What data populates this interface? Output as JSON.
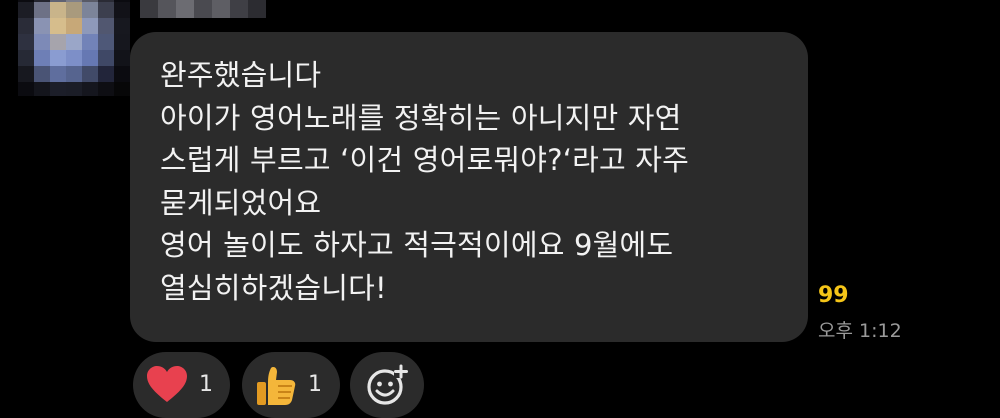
{
  "avatar": {
    "pixels": [
      "#0b0b10",
      "#23242e",
      "#5f6273",
      "#7e7f8a",
      "#585a66",
      "#2a2b35",
      "#0b0b10",
      "#1c1d25",
      "#6d7186",
      "#c9b48a",
      "#a99a7d",
      "#7c8499",
      "#3c3f4e",
      "#121218",
      "#2a2c38",
      "#8a93b3",
      "#d6bd8c",
      "#c7a878",
      "#8e99ba",
      "#515770",
      "#17181f",
      "#2e3140",
      "#7d8ab7",
      "#a6a4ac",
      "#9aa6c8",
      "#7283b8",
      "#4e5878",
      "#16171e",
      "#262935",
      "#6e7fb6",
      "#8a9cd1",
      "#7d8fc8",
      "#6678b3",
      "#3f4866",
      "#121319",
      "#17181f",
      "#4a5475",
      "#5f6e9e",
      "#56648f",
      "#414a68",
      "#22253a",
      "#0b0b10",
      "#0b0b10",
      "#14151c",
      "#1c1e29",
      "#1b1d27",
      "#15161e",
      "#0e0e13",
      "#070708"
    ]
  },
  "sender_name_blur": [
    "#3a3a3f",
    "#55555b",
    "#6c6c72",
    "#4a4a50",
    "#5e5e64",
    "#3f3f45",
    "#2c2c31"
  ],
  "message": {
    "lines": [
      "완주했습니다",
      "아이가 영어노래를 정확히는 아니지만 자연",
      "스럽게 부르고 ‘이건 영어로뭐야?‘라고 자주",
      "묻게되었어요",
      "영어 놀이도 하자고 적극적이에요 9월에도",
      "열심히하겠습니다!"
    ],
    "unread_count": "99",
    "time": "오후 1:12"
  },
  "reactions": [
    {
      "icon": "heart-icon",
      "count": "1"
    },
    {
      "icon": "thumbs-up-icon",
      "count": "1"
    },
    {
      "icon": "add-reaction-icon"
    }
  ],
  "colors": {
    "background": "#000000",
    "bubble": "#2b2b2b",
    "unread": "#f5c518",
    "heart": "#e8414f",
    "thumb": "#f4b63a"
  }
}
